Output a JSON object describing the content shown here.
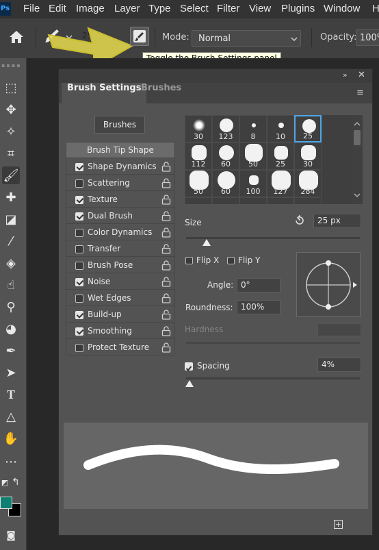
{
  "app": {
    "logo": "Ps"
  },
  "menu": [
    "File",
    "Edit",
    "Image",
    "Layer",
    "Type",
    "Select",
    "Filter",
    "View",
    "Plugins",
    "Window",
    "H"
  ],
  "options_bar": {
    "brush_size": "25",
    "mode_label": "Mode:",
    "mode_value": "Normal",
    "opacity_label": "Opacity:",
    "opacity_value": "100%",
    "tooltip": "Toggle the Brush Settings panel"
  },
  "colors": {
    "foreground": "#0f7f72",
    "background": "#000000",
    "accent": "#4fa6e8",
    "arrow": "#e7dc4e"
  },
  "panel": {
    "tabs": [
      "Brush Settings",
      "Brushes"
    ],
    "brushes_button": "Brushes",
    "tip_shape_header": "Brush Tip Shape",
    "options": [
      {
        "label": "Shape Dynamics",
        "checked": true
      },
      {
        "label": "Scattering",
        "checked": false
      },
      {
        "label": "Texture",
        "checked": true
      },
      {
        "label": "Dual Brush",
        "checked": true
      },
      {
        "label": "Color Dynamics",
        "checked": false
      },
      {
        "label": "Transfer",
        "checked": false
      },
      {
        "label": "Brush Pose",
        "checked": false
      },
      {
        "label": "Noise",
        "checked": true
      },
      {
        "label": "Wet Edges",
        "checked": false
      },
      {
        "label": "Build-up",
        "checked": true
      },
      {
        "label": "Smoothing",
        "checked": true
      },
      {
        "label": "Protect Texture",
        "checked": false
      }
    ],
    "tips": [
      "30",
      "123",
      "8",
      "10",
      "25",
      "112",
      "60",
      "50",
      "25",
      "30",
      "50",
      "60",
      "100",
      "127",
      "284",
      "",
      "",
      "",
      "",
      ""
    ],
    "selected_tip": 4,
    "size_label": "Size",
    "size_value": "25 px",
    "size_level": 0.12,
    "flip_x": "Flip X",
    "flip_y": "Flip Y",
    "angle_label": "Angle:",
    "angle_value": "0°",
    "roundness_label": "Roundness:",
    "roundness_value": "100%",
    "hardness_label": "Hardness",
    "spacing_label": "Spacing",
    "spacing_checked": true,
    "spacing_value": "4%",
    "spacing_level": 0.02
  }
}
